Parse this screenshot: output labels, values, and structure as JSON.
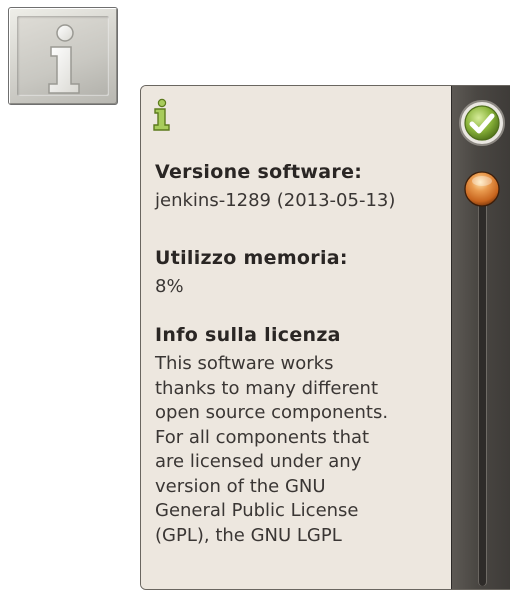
{
  "info_button": {
    "icon": "info-icon"
  },
  "dialog": {
    "header_icon": "info-icon",
    "sections": [
      {
        "title": "Versione software:",
        "value": "jenkins-1289 (2013-05-13)"
      },
      {
        "title": "Utilizzo memoria:",
        "value": "8%"
      },
      {
        "title": "Info sulla licenza",
        "lines": [
          "This software works",
          "thanks to many different",
          "open source components.",
          "For all components that",
          "are licensed under any",
          "version of the GNU",
          "General Public License",
          "(GPL), the GNU LGPL"
        ]
      }
    ]
  },
  "scroll_panel": {
    "ok_icon": "checkmark-icon",
    "scroll_position": 0
  },
  "colors": {
    "accent_green": "#8ab43a",
    "thumb_orange": "#c8651e",
    "panel_dark": "#4a4743"
  }
}
